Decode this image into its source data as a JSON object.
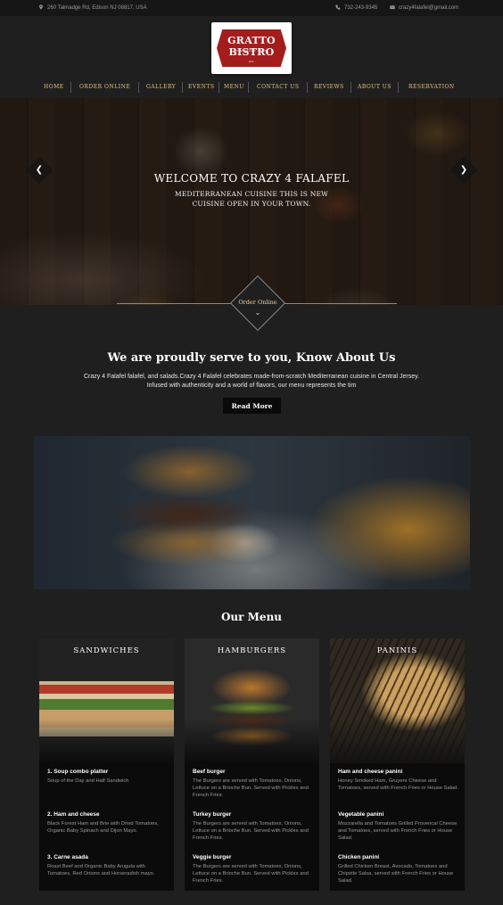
{
  "topbar": {
    "address": "260 Talmadge Rd, Edison NJ 08817, USA",
    "phone": "732-243-9345",
    "email": "crazy4falafel@gmail.com"
  },
  "logo": {
    "name": "GRATTO BISTRO",
    "tagline": "HOMEMADE FOOD",
    "est": "EST."
  },
  "nav": [
    "HOME",
    "ORDER ONLINE",
    "GALLERY",
    "EVENTS",
    "MENU",
    "CONTACT US",
    "REVIEWS",
    "ABOUT US",
    "RESERVATION"
  ],
  "hero": {
    "title": "WELCOME TO CRAZY 4 FALAFEL",
    "subtitle": "MEDITERRANEAN CUISINE THIS IS NEW CUISINE OPEN IN YOUR TOWN.",
    "prev_glyph": "❮",
    "next_glyph": "❯"
  },
  "order": {
    "label": "Order Online",
    "chevron": "⌄"
  },
  "about": {
    "title": "We are proudly serve to you, Know About Us",
    "text": "Crazy 4 Falafel falafel, and salads.Crazy 4 Falafel celebrates made-from-scratch Mediterranean cuisine in Central Jersey. Infused with authenticity and a world of flavors, our menu represents the tim",
    "button": "Read More"
  },
  "menu": {
    "title": "Our Menu",
    "cards": [
      {
        "title": "SANDWICHES",
        "items": [
          {
            "name": "1. Soup combo platter",
            "desc": "Soup of the Day and Half Sandwich"
          },
          {
            "name": "2. Ham and cheese",
            "desc": "Black Forest Ham and Brie with Dried Tomatoes, Organic Baby Spinach and Dijon Mayo."
          },
          {
            "name": "3. Carne asada",
            "desc": "Roast Beef and Organic Baby Arugula with Tomatoes, Red Onions and Horseradish mayo."
          }
        ]
      },
      {
        "title": "HAMBURGERS",
        "items": [
          {
            "name": "Beef burger",
            "desc": "The Burgers are served with Tomatoes, Onions, Lettuce on a Brioche Bun. Served with Pickles and French Fries."
          },
          {
            "name": "Turkey burger",
            "desc": "The Burgers are served with Tomatoes, Onions, Lettuce on a Brioche Bun. Served with Pickles and French Fries."
          },
          {
            "name": "Veggie burger",
            "desc": "The Burgers are served with Tomatoes, Onions, Lettuce on a Brioche Bun. Served with Pickles and French Fries."
          }
        ]
      },
      {
        "title": "PANINIS",
        "items": [
          {
            "name": "Ham and cheese panini",
            "desc": "Honey Smoked Ham, Gruyere Cheese and Tomatoes, served with French Fries or House Salad."
          },
          {
            "name": "Vegetable panini",
            "desc": "Mozzarella and Tomatoes Grilled Provencal Cheese and Tomatoes, served with French Fries or House Salad."
          },
          {
            "name": "Chicken panini",
            "desc": "Grilled Chicken Breast, Avocado, Tomatoes and Chipotle Salsa, served with French Fries or House Salad."
          }
        ]
      }
    ]
  },
  "colors": {
    "background": "#1f1f1f",
    "nav_text": "#e0c58a",
    "logo_red": "#a41d1d",
    "card_bg": "#0b0b0b"
  }
}
